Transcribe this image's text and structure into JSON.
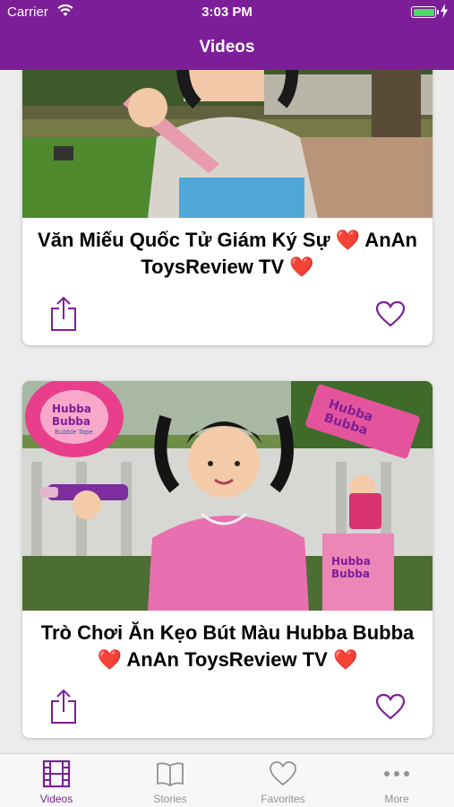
{
  "status_bar": {
    "carrier": "Carrier",
    "time": "3:03 PM"
  },
  "nav": {
    "title": "Videos"
  },
  "videos": [
    {
      "title": "Văn Miếu Quốc Tử Giám Ký Sự ❤️ AnAn ToysReview TV ❤️"
    },
    {
      "title": "Trò Chơi Ăn Kẹo Bút Màu Hubba Bubba ❤️ AnAn ToysReview TV ❤️"
    }
  ],
  "thumb_text": {
    "hubba_1": "Hubba",
    "bubba_1": "Bubba",
    "tape": "Bubble Tape",
    "hubba_2": "Hubba",
    "bubba_2": "Bubba",
    "hubba_3": "Hubba",
    "bubba_3": "Bubba"
  },
  "tabs": [
    {
      "label": "Videos",
      "icon": "film-icon"
    },
    {
      "label": "Stories",
      "icon": "book-icon"
    },
    {
      "label": "Favorites",
      "icon": "heart-icon"
    },
    {
      "label": "More",
      "icon": "more-icon"
    }
  ],
  "colors": {
    "brand": "#7D1E99",
    "tab_inactive": "#929292",
    "heart": "#7D1E99"
  }
}
